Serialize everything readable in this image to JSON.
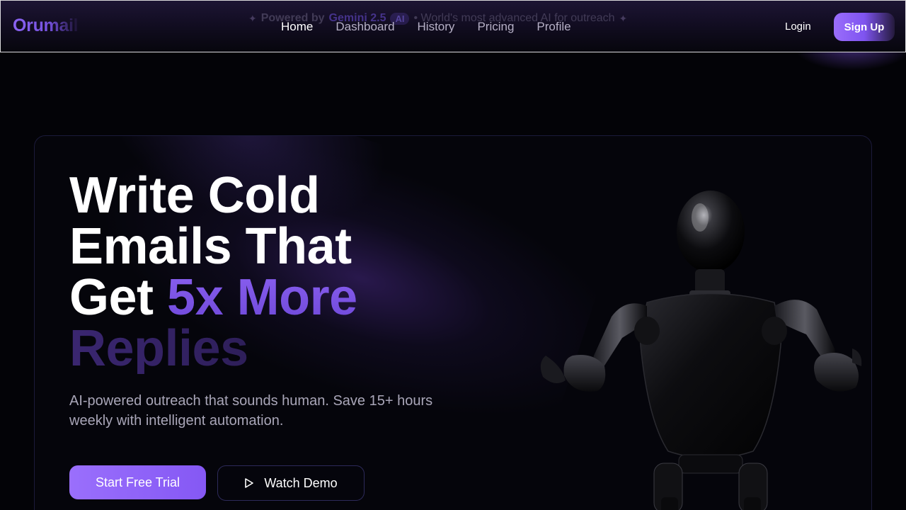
{
  "announcement": {
    "prefix": "Powered by",
    "brand": "Gemini 2.5",
    "badge": "AI",
    "tail": "• World's most advanced AI for outreach"
  },
  "header": {
    "logo": "Orumail",
    "nav": [
      {
        "label": "Home",
        "active": true
      },
      {
        "label": "Dashboard",
        "active": false
      },
      {
        "label": "History",
        "active": false
      },
      {
        "label": "Pricing",
        "active": false
      },
      {
        "label": "Profile",
        "active": false
      }
    ],
    "login_label": "Login",
    "signup_label": "Sign Up"
  },
  "hero": {
    "headline_line1": "Write Cold",
    "headline_line2": "Emails That",
    "headline_line3_plain": "Get ",
    "headline_line3_accent": "5x More",
    "headline_line4": "Replies",
    "subtitle": "AI-powered outreach that sounds human. Save 15+ hours weekly with intelligent automation.",
    "primary_cta": "Start Free Trial",
    "secondary_cta": "Watch Demo"
  },
  "colors": {
    "accent": "#8b5cf6",
    "background": "#030307",
    "border": "#1b1a3a"
  },
  "icons": {
    "sparkle": "sparkle-icon",
    "play": "play-icon"
  }
}
